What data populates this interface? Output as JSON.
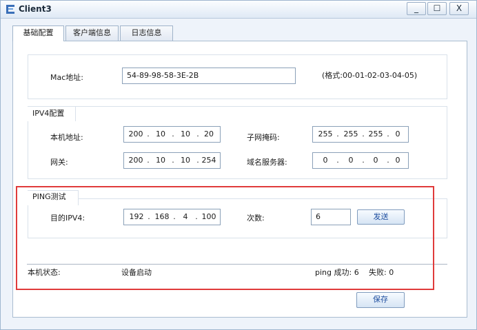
{
  "window": {
    "title": "Client3",
    "icon": "client-app-icon",
    "controls": {
      "minimize": "_",
      "maximize": "☐",
      "close": "X"
    }
  },
  "tabs": [
    {
      "label": "基础配置",
      "active": true
    },
    {
      "label": "客户端信息",
      "active": false
    },
    {
      "label": "日志信息",
      "active": false
    }
  ],
  "mac_section": {
    "label": "Mac地址:",
    "value": "54-89-98-58-3E-2B",
    "format_hint": "(格式:00-01-02-03-04-05)"
  },
  "ipv4_section": {
    "title": "IPV4配置",
    "local_ip_label": "本机地址:",
    "local_ip": [
      "200",
      "10",
      "10",
      "20"
    ],
    "subnet_label": "子网掩码:",
    "subnet": [
      "255",
      "255",
      "255",
      "0"
    ],
    "gateway_label": "网关:",
    "gateway": [
      "200",
      "10",
      "10",
      "254"
    ],
    "dns_label": "域名服务器:",
    "dns": [
      "0",
      "0",
      "0",
      "0"
    ]
  },
  "ping_section": {
    "title": "PING测试",
    "dest_label": "目的IPV4:",
    "dest_ip": [
      "192",
      "168",
      "4",
      "100"
    ],
    "count_label": "次数:",
    "count_value": "6",
    "send_button": "发送"
  },
  "status": {
    "label": "本机状态:",
    "value": "设备启动",
    "ping_success": "ping 成功: 6",
    "fail": "失败: 0"
  },
  "save_button": "保存",
  "colors": {
    "highlight_border": "#e03a3a",
    "window_bg": "#eef3fa",
    "button_text": "#1f4fa0"
  }
}
